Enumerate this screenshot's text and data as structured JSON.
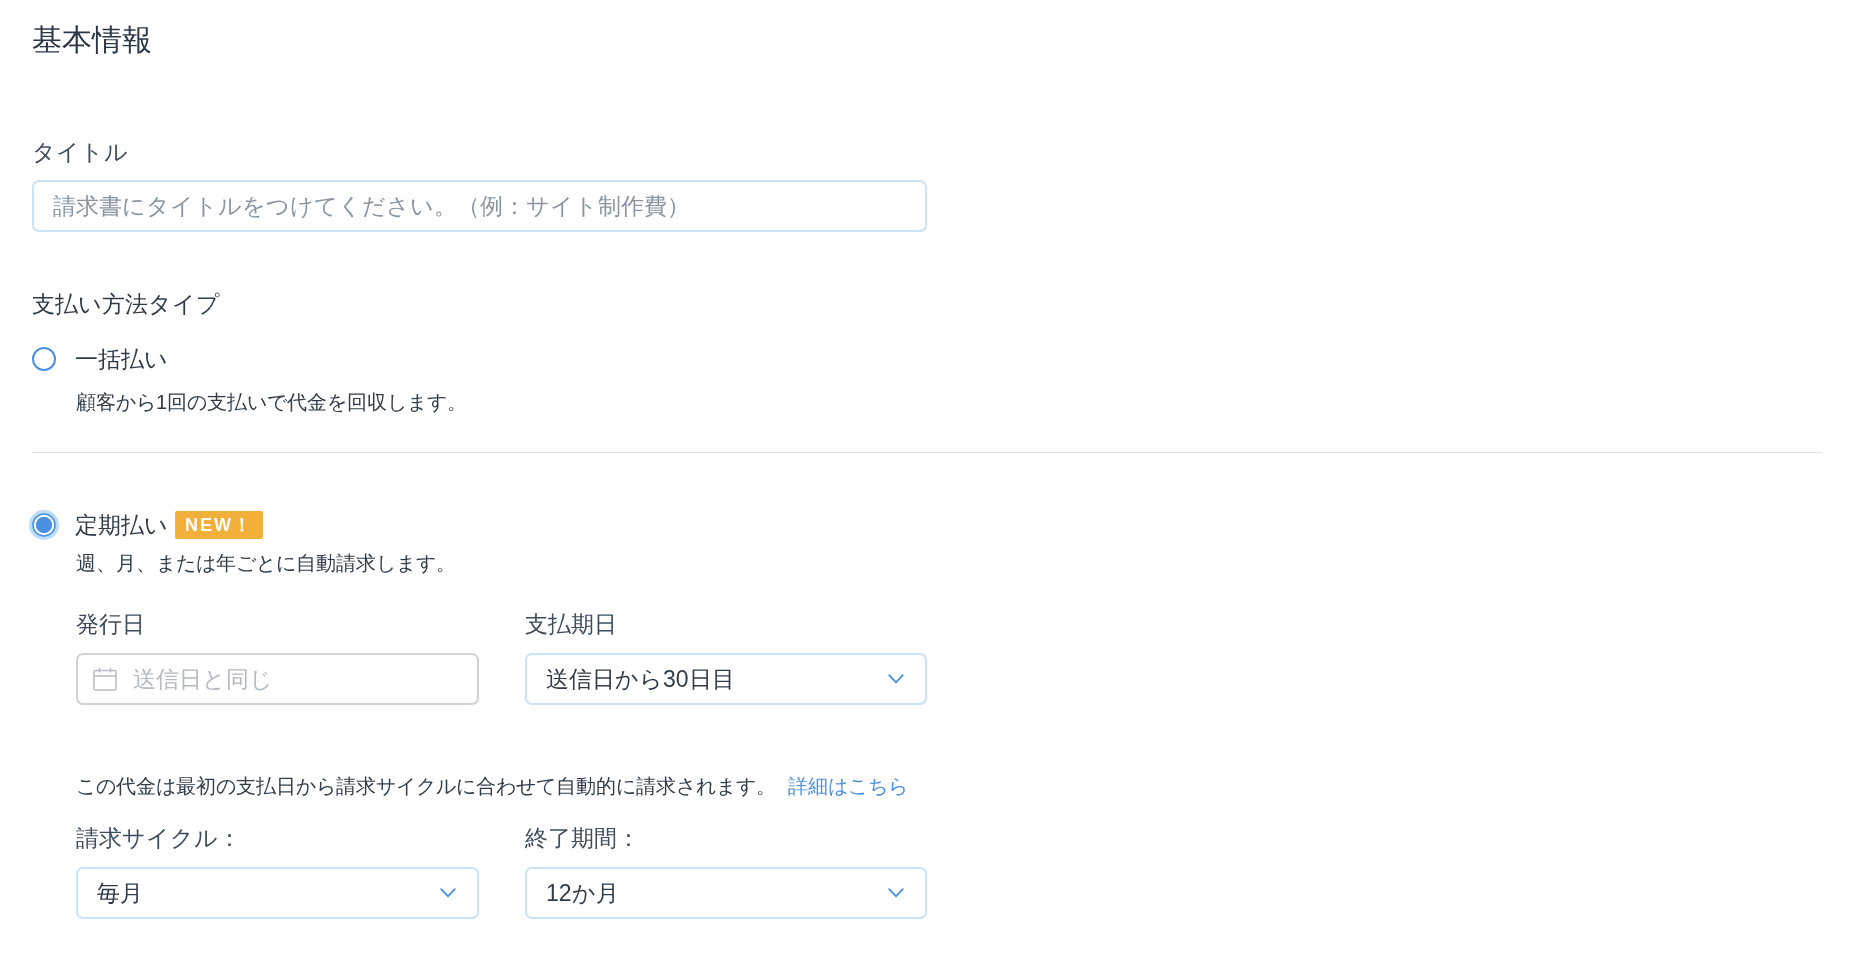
{
  "section_title": "基本情報",
  "title_field": {
    "label": "タイトル",
    "placeholder": "請求書にタイトルをつけてください。（例：サイト制作費）"
  },
  "payment_type": {
    "label": "支払い方法タイプ",
    "options": [
      {
        "label": "一括払い",
        "description": "顧客から1回の支払いで代金を回収します。",
        "selected": false
      },
      {
        "label": "定期払い",
        "badge": "NEW！",
        "description": "週、月、または年ごとに自動請求します。",
        "selected": true,
        "settings": {
          "date_fields": [
            {
              "kind": "date",
              "label": "発行日",
              "placeholder": "送信日と同じ"
            },
            {
              "kind": "select",
              "label": "支払期日",
              "value": "送信日から30日目"
            }
          ],
          "note": "この代金は最初の支払日から請求サイクルに合わせて自動的に請求されます。",
          "note_link": "詳細はこちら",
          "cycle_fields": [
            {
              "kind": "select",
              "label": "請求サイクル：",
              "value": "毎月"
            },
            {
              "kind": "select",
              "label": "終了期間：",
              "value": "12か月"
            }
          ]
        }
      }
    ]
  }
}
